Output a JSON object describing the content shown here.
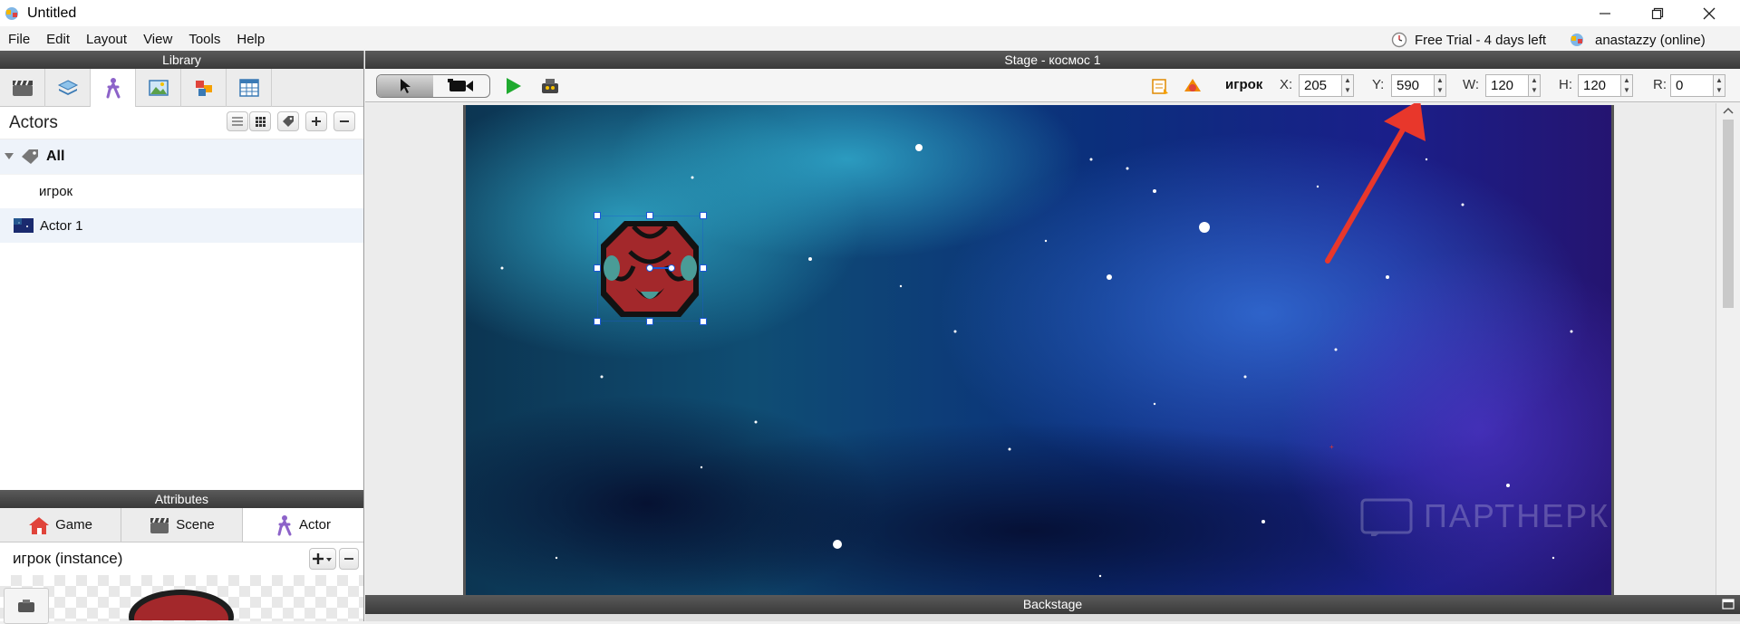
{
  "window": {
    "title": "Untitled",
    "minimize_icon": "minimize-icon",
    "restore_icon": "restore-icon",
    "close_icon": "close-icon"
  },
  "menu": {
    "items": [
      "File",
      "Edit",
      "Layout",
      "View",
      "Tools",
      "Help"
    ]
  },
  "status": {
    "trial": "Free Trial - 4 days left",
    "user": "anastazzy (online)"
  },
  "library": {
    "header": "Library",
    "tabs": [
      "scenes-icon",
      "layers-icon",
      "actors-icon",
      "images-icon",
      "behaviors-icon",
      "tables-icon"
    ],
    "section_title": "Actors",
    "tree": {
      "group_label": "All",
      "items": [
        {
          "label": "игрок"
        },
        {
          "label": "Actor 1"
        }
      ]
    }
  },
  "attributes": {
    "header": "Attributes",
    "tabs": [
      {
        "label": "Game",
        "icon": "home-icon"
      },
      {
        "label": "Scene",
        "icon": "clapper-icon"
      },
      {
        "label": "Actor",
        "icon": "actor-icon"
      }
    ],
    "instance_label": "игрок (instance)"
  },
  "stage": {
    "header": "Stage - космос 1",
    "selected_actor": "игрок",
    "x_label": "X:",
    "x_value": "205",
    "y_label": "Y:",
    "y_value": "590",
    "w_label": "W:",
    "w_value": "120",
    "h_label": "H:",
    "h_value": "120",
    "r_label": "R:",
    "r_value": "0",
    "watermark": "ПАРТНЕРКИН"
  },
  "backstage": {
    "header": "Backstage"
  },
  "colors": {
    "annotation_arrow": "#e8372b",
    "selection_handle": "#1a57d6",
    "panel_header": "#4a4a4a"
  }
}
